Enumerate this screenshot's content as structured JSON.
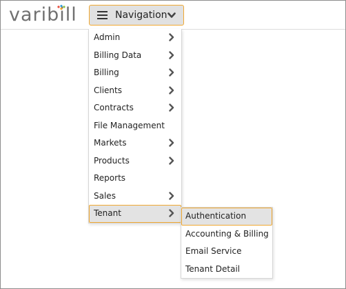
{
  "header": {
    "logo_text": "varibill",
    "nav_button_label": "Navigation",
    "nav_button_icon": "hamburger-icon",
    "nav_chevron_icon": "chevron-down-icon"
  },
  "colors": {
    "accent_border": "#f0a830",
    "highlight_bg": "#e3e3e3",
    "logo_dot_1": "#e74c3c",
    "logo_dot_2": "#3aa0d8",
    "logo_dot_3": "#8bc34a",
    "logo_dot_4": "#f5a623"
  },
  "menu": {
    "items": [
      {
        "label": "Admin",
        "has_submenu": true
      },
      {
        "label": "Billing Data",
        "has_submenu": true
      },
      {
        "label": "Billing",
        "has_submenu": true
      },
      {
        "label": "Clients",
        "has_submenu": true
      },
      {
        "label": "Contracts",
        "has_submenu": true
      },
      {
        "label": "File Management",
        "has_submenu": false
      },
      {
        "label": "Markets",
        "has_submenu": true
      },
      {
        "label": "Products",
        "has_submenu": true
      },
      {
        "label": "Reports",
        "has_submenu": false
      },
      {
        "label": "Sales",
        "has_submenu": true
      },
      {
        "label": "Tenant",
        "has_submenu": true,
        "active": true
      }
    ]
  },
  "submenu": {
    "items": [
      {
        "label": "Authentication",
        "active": true
      },
      {
        "label": "Accounting & Billing"
      },
      {
        "label": "Email Service"
      },
      {
        "label": "Tenant Detail"
      }
    ]
  }
}
